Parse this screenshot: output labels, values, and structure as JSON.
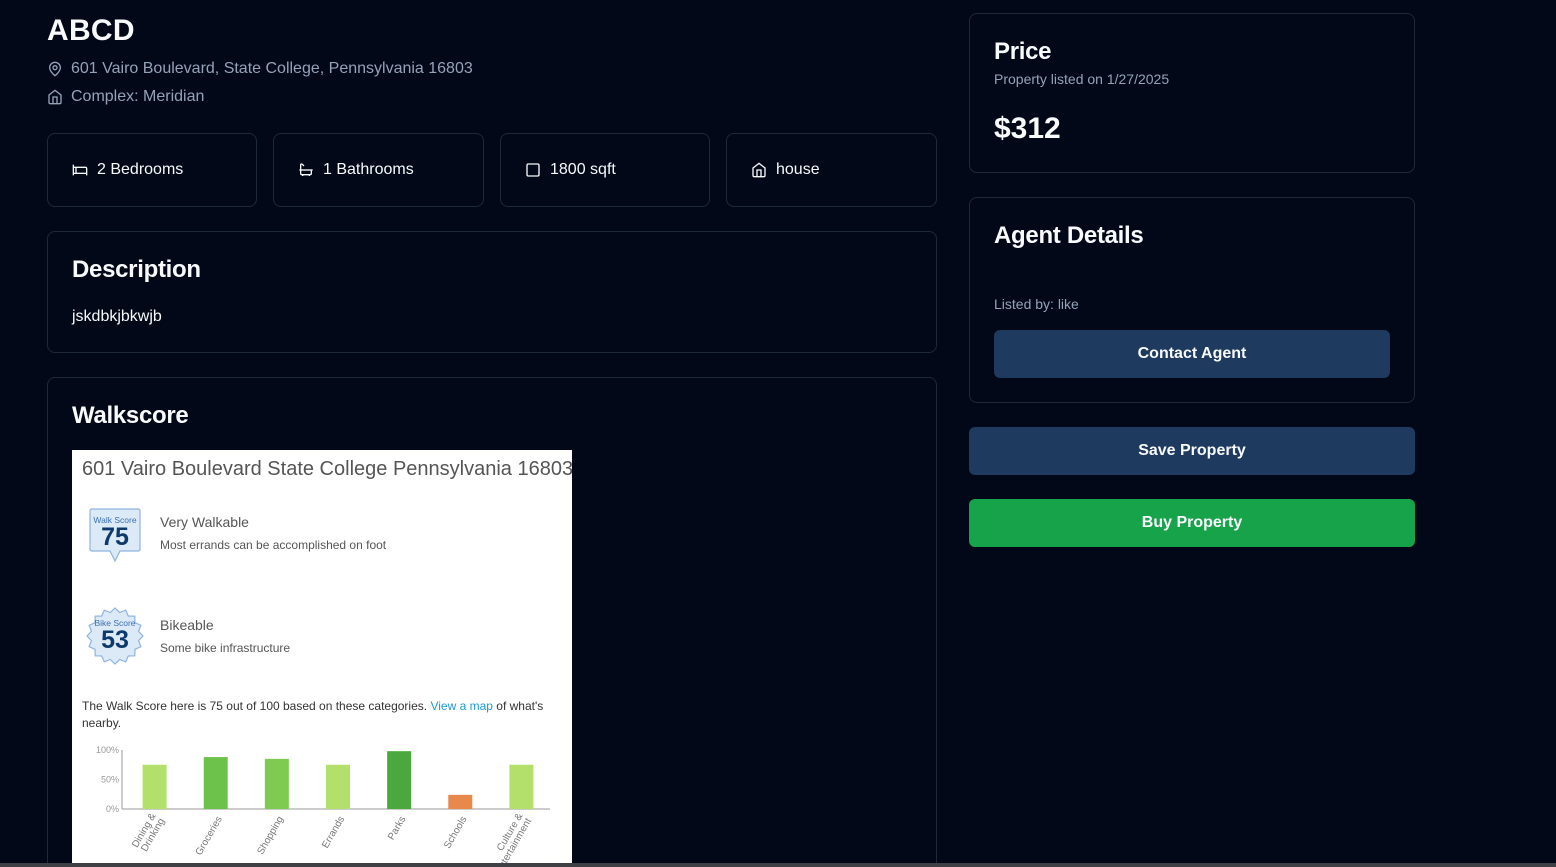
{
  "property": {
    "title": "ABCD",
    "address": "601 Vairo Boulevard, State College, Pennsylvania 16803",
    "complex": "Complex: Meridian"
  },
  "features": [
    {
      "icon": "bed-icon",
      "label": "2 Bedrooms"
    },
    {
      "icon": "bath-icon",
      "label": "1 Bathrooms"
    },
    {
      "icon": "square-icon",
      "label": "1800 sqft"
    },
    {
      "icon": "home-icon",
      "label": "house"
    }
  ],
  "description": {
    "heading": "Description",
    "text": "jskdbkjbkwjb"
  },
  "walkscore": {
    "heading": "Walkscore",
    "address": "601 Vairo Boulevard State College Pennsylvania 16803",
    "walk": {
      "badge_label": "Walk Score",
      "score": "75",
      "title": "Very Walkable",
      "desc": "Most errands can be accomplished on foot"
    },
    "bike": {
      "badge_label": "Bike Score",
      "score": "53",
      "title": "Bikeable",
      "desc": "Some bike infrastructure"
    },
    "summary_prefix": "The Walk Score here is 75 out of 100 based on these categories.",
    "summary_link": "View a map",
    "summary_suffix": "of what's nearby."
  },
  "chart_data": {
    "type": "bar",
    "categories": [
      "Dining & Drinking",
      "Groceries",
      "Shopping",
      "Errands",
      "Parks",
      "Schools",
      "Culture & Entertainment"
    ],
    "tick_lines": [
      [
        "Dining &",
        "Drinking"
      ],
      [
        "Groceries"
      ],
      [
        "Shopping"
      ],
      [
        "Errands"
      ],
      [
        "Parks"
      ],
      [
        "Schools"
      ],
      [
        "Culture &",
        "Entertainment"
      ]
    ],
    "values": [
      75,
      88,
      85,
      75,
      98,
      24,
      75
    ],
    "colors": [
      "#b2e06a",
      "#6cc24a",
      "#7fcb52",
      "#b2e06a",
      "#4aa83c",
      "#e8894b",
      "#b2e06a"
    ],
    "yticks": [
      "100%",
      "50%",
      "0%"
    ],
    "ylim": [
      0,
      100
    ]
  },
  "price": {
    "heading": "Price",
    "listed": "Property listed on 1/27/2025",
    "amount": "$312"
  },
  "agent": {
    "heading": "Agent Details",
    "listed_by": "Listed by: like",
    "contact_label": "Contact Agent"
  },
  "actions": {
    "save_label": "Save Property",
    "buy_label": "Buy Property"
  },
  "colors": {
    "background": "#020817",
    "border": "#1e293b",
    "muted_text": "#94a3b8",
    "primary_button": "#1e3a5f",
    "buy_button": "#16a34a"
  }
}
